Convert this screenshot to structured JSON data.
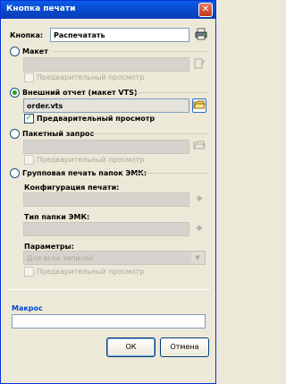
{
  "window": {
    "title": "Кнопка печати",
    "close_glyph": "✕"
  },
  "button_field": {
    "label": "Кнопка:",
    "value": "Распечатать"
  },
  "option_maket": {
    "label": "Макет",
    "preview_label": "Предварительный просмотр",
    "selected": false
  },
  "option_external": {
    "label": "Внешний отчет (макет VTS)",
    "value": "order.vts",
    "preview_label": "Предварительный просмотр",
    "selected": true,
    "preview_checked": true
  },
  "option_batch": {
    "label": "Пакетный запрос",
    "preview_label": "Предварительный просмотр",
    "selected": false
  },
  "option_group": {
    "label": "Групповая печать папок ЭМК:",
    "config_label": "Конфигурация печати:",
    "folder_type_label": "Тип папки ЭМК:",
    "params_label": "Параметры:",
    "params_value": "Для всех записей",
    "preview_label": "Предварительный просмотр",
    "selected": false
  },
  "macro": {
    "label": "Макрос",
    "value": ""
  },
  "footer": {
    "ok_label": "ОК",
    "cancel_label": "Отмена"
  },
  "colors": {
    "accent": "#0046d5",
    "title_bar": "#0a5de8",
    "radio_dot": "#21a121"
  }
}
